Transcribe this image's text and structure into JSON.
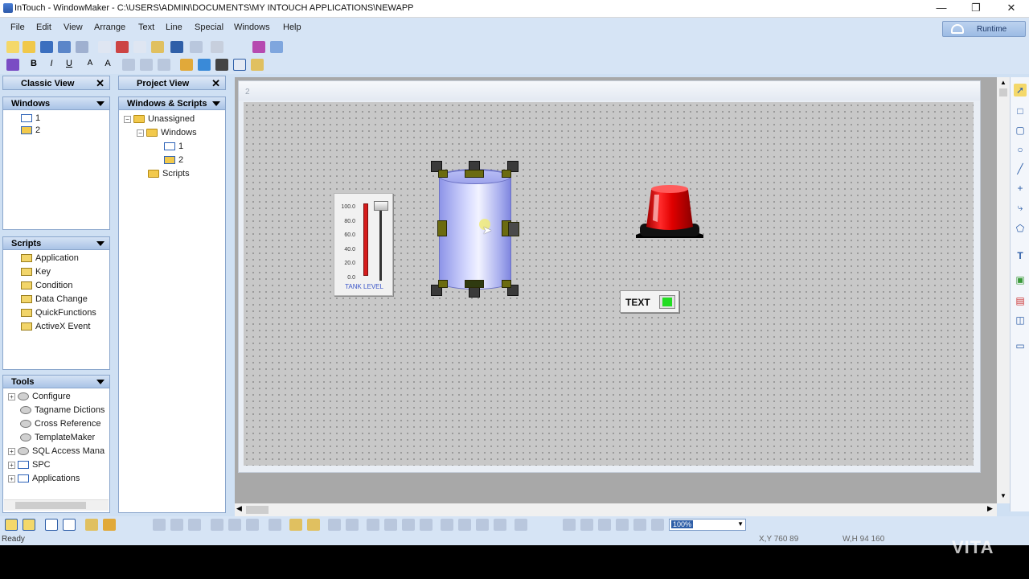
{
  "window": {
    "title": "InTouch - WindowMaker - C:\\USERS\\ADMIN\\DOCUMENTS\\MY INTOUCH APPLICATIONS\\NEWAPP",
    "min": "—",
    "restore": "❐",
    "close": "✕"
  },
  "menu": [
    "File",
    "Edit",
    "View",
    "Arrange",
    "Text",
    "Line",
    "Special",
    "Windows",
    "Help"
  ],
  "runtime_label": "Runtime",
  "classic_view": {
    "title": "Classic View",
    "windows_header": "Windows",
    "windows": [
      "1",
      "2"
    ],
    "scripts_header": "Scripts",
    "scripts": [
      "Application",
      "Key",
      "Condition",
      "Data Change",
      "QuickFunctions",
      "ActiveX Event"
    ],
    "tools_header": "Tools",
    "tools": [
      "Configure",
      "Tagname Dictions",
      "Cross Reference",
      "TemplateMaker",
      "SQL Access Mana",
      "SPC",
      "Applications"
    ]
  },
  "project_view": {
    "title": "Project View",
    "header": "Windows & Scripts",
    "root": "Unassigned",
    "windows_folder": "Windows",
    "windows": [
      "1",
      "2"
    ],
    "scripts_folder": "Scripts"
  },
  "canvas": {
    "window_caption": "2",
    "slider": {
      "ticks": [
        "100.0",
        "80.0",
        "60.0",
        "40.0",
        "20.0",
        "0.0"
      ],
      "label": "TANK LEVEL"
    },
    "text_label": "TEXT"
  },
  "zoom": "100%",
  "status": {
    "ready": "Ready",
    "xy": "X,Y 760      89",
    "wh": "W,H 94      160"
  },
  "watermark": "VITA",
  "colors": {
    "menubar": "#d6e4f5",
    "grid": "#c8c8c8",
    "tank": "#b8bdf5",
    "light": "#e00000",
    "text_indicator": "#22dd22"
  }
}
